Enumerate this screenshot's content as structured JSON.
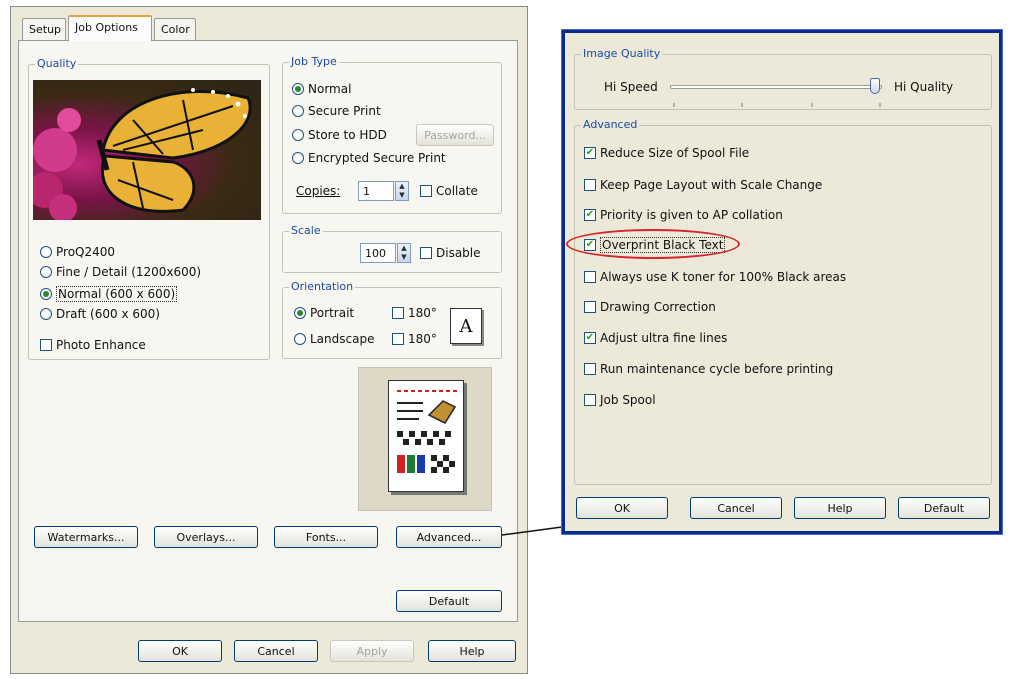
{
  "main_dialog": {
    "tabs": [
      {
        "label": "Setup",
        "active": false
      },
      {
        "label": "Job Options",
        "active": true
      },
      {
        "label": "Color",
        "active": false
      }
    ],
    "quality": {
      "legend": "Quality",
      "options": [
        {
          "label": "ProQ2400",
          "selected": false
        },
        {
          "label": "Fine / Detail (1200x600)",
          "selected": false
        },
        {
          "label": "Normal (600 x 600)",
          "selected": true
        },
        {
          "label": "Draft (600 x 600)",
          "selected": false
        }
      ],
      "photo_enhance": {
        "label": "Photo Enhance",
        "checked": false
      }
    },
    "job_type": {
      "legend": "Job Type",
      "options": [
        {
          "label": "Normal",
          "selected": true
        },
        {
          "label": "Secure Print",
          "selected": false
        },
        {
          "label": "Store to HDD",
          "selected": false
        },
        {
          "label": "Encrypted Secure Print",
          "selected": false
        }
      ],
      "password_label": "Password...",
      "copies_label": "Copies:",
      "copies_value": "1",
      "collate": {
        "label": "Collate",
        "checked": false
      }
    },
    "scale": {
      "legend": "Scale",
      "value": "100",
      "disable": {
        "label": "Disable",
        "checked": false
      }
    },
    "orientation": {
      "legend": "Orientation",
      "portrait": {
        "label": "Portrait",
        "selected": true
      },
      "landscape": {
        "label": "Landscape",
        "selected": false
      },
      "rotate_portrait": {
        "label": "180°",
        "checked": false
      },
      "rotate_landscape": {
        "label": "180°",
        "checked": false
      },
      "icon_letter": "A"
    },
    "buttons": {
      "watermarks": "Watermarks...",
      "overlays": "Overlays...",
      "fonts": "Fonts...",
      "advanced": "Advanced...",
      "default": "Default",
      "ok": "OK",
      "cancel": "Cancel",
      "apply": "Apply",
      "help": "Help"
    }
  },
  "advanced_dialog": {
    "image_quality": {
      "legend": "Image Quality",
      "left_label": "Hi Speed",
      "right_label": "Hi Quality",
      "slider_position": 1.0
    },
    "advanced": {
      "legend": "Advanced",
      "options": [
        {
          "label": "Reduce Size of Spool File",
          "checked": true,
          "highlighted": false
        },
        {
          "label": "Keep Page Layout with Scale Change",
          "checked": false,
          "highlighted": false
        },
        {
          "label": "Priority is given to AP collation",
          "checked": true,
          "highlighted": false
        },
        {
          "label": "Overprint Black Text",
          "checked": true,
          "highlighted": true
        },
        {
          "label": "Always use K toner for 100% Black areas",
          "checked": false,
          "highlighted": false
        },
        {
          "label": "Drawing Correction",
          "checked": false,
          "highlighted": false
        },
        {
          "label": "Adjust ultra fine lines",
          "checked": true,
          "highlighted": false
        },
        {
          "label": "Run maintenance cycle before printing",
          "checked": false,
          "highlighted": false
        },
        {
          "label": "Job Spool",
          "checked": false,
          "highlighted": false
        }
      ]
    },
    "buttons": {
      "ok": "OK",
      "cancel": "Cancel",
      "help": "Help",
      "default": "Default"
    }
  },
  "colors": {
    "dialog_bg": "#ece9d8",
    "legend_blue": "#1a4aa8",
    "highlight_red": "#d8262c",
    "frame_blue": "#0a2a8c"
  }
}
